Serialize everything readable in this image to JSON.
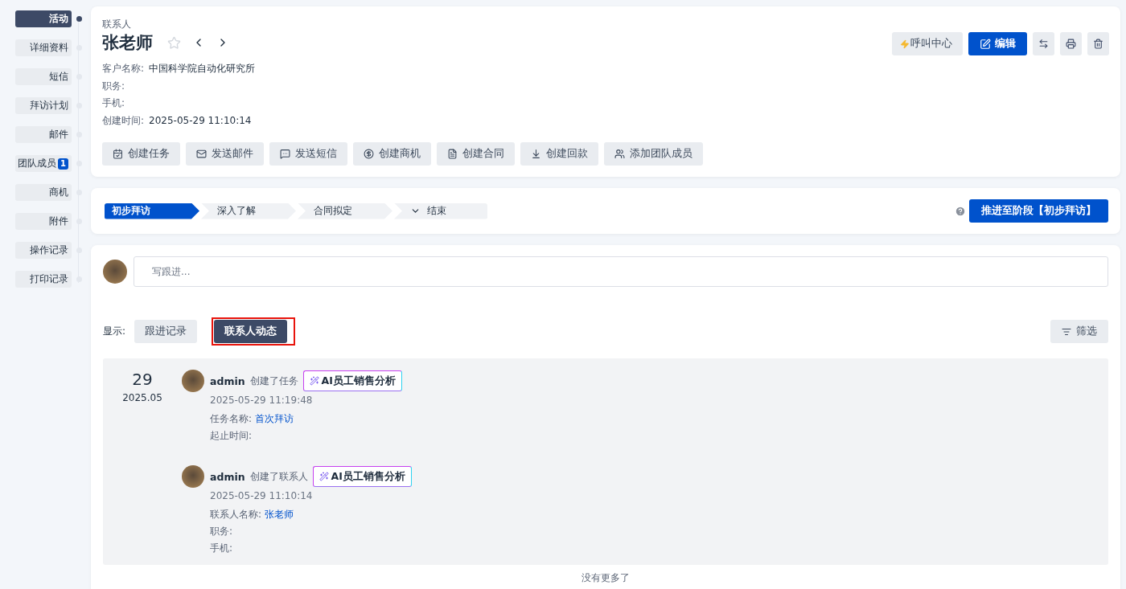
{
  "nav": [
    {
      "label": "活动",
      "selected": true
    },
    {
      "label": "详细资料",
      "selected": false
    },
    {
      "label": "短信",
      "selected": false
    },
    {
      "label": "拜访计划",
      "selected": false
    },
    {
      "label": "邮件",
      "selected": false
    },
    {
      "label": "团队成员",
      "selected": false,
      "badge": "1"
    },
    {
      "label": "商机",
      "selected": false
    },
    {
      "label": "附件",
      "selected": false
    },
    {
      "label": "操作记录",
      "selected": false
    },
    {
      "label": "打印记录",
      "selected": false
    }
  ],
  "header": {
    "breadcrumb": "联系人",
    "name": "张老师",
    "starred": false,
    "fields": [
      {
        "label": "客户名称:",
        "value": "中国科学院自动化研究所"
      },
      {
        "label": "职务:"
      },
      {
        "label": "手机:"
      },
      {
        "label": "创建时间:",
        "value": "2025-05-29 11:10:14"
      }
    ],
    "call_button": "呼叫中心",
    "edit_button": "编辑"
  },
  "quick_actions": [
    "创建任务",
    "发送邮件",
    "发送短信",
    "创建商机",
    "创建合同",
    "创建回款",
    "添加团队成员"
  ],
  "stages": [
    {
      "label": "初步拜访",
      "selected": true,
      "kind": "step"
    },
    {
      "label": "深入了解",
      "selected": false,
      "kind": "step"
    },
    {
      "label": "合同拟定",
      "selected": false,
      "kind": "step"
    },
    {
      "label": "结束",
      "selected": false,
      "kind": "dropdown"
    }
  ],
  "advance_button": "推进至阶段【初步拜访】",
  "composer": {
    "placeholder": "写跟进..."
  },
  "display": {
    "label": "显示:",
    "tabs": [
      {
        "label": "跟进记录",
        "selected": false,
        "highlighted": false
      },
      {
        "label": "联系人动态",
        "selected": true,
        "highlighted": true
      }
    ],
    "filter_button": "筛选"
  },
  "feed": {
    "day": "29",
    "month": "2025.05",
    "entries": [
      {
        "user": "admin",
        "action": "创建了任务",
        "ai_label": "AI员工销售分析",
        "time": "2025-05-29 11:19:48",
        "fields": [
          {
            "label": "任务名称:",
            "value": "首次拜访"
          },
          {
            "label": "起止时间:"
          }
        ]
      },
      {
        "user": "admin",
        "action": "创建了联系人",
        "ai_label": "AI员工销售分析",
        "time": "2025-05-29 11:10:14",
        "fields": [
          {
            "label": "联系人名称:",
            "value": "张老师"
          },
          {
            "label": "职务:"
          },
          {
            "label": "手机:"
          }
        ]
      }
    ]
  },
  "footer": "没有更多了"
}
